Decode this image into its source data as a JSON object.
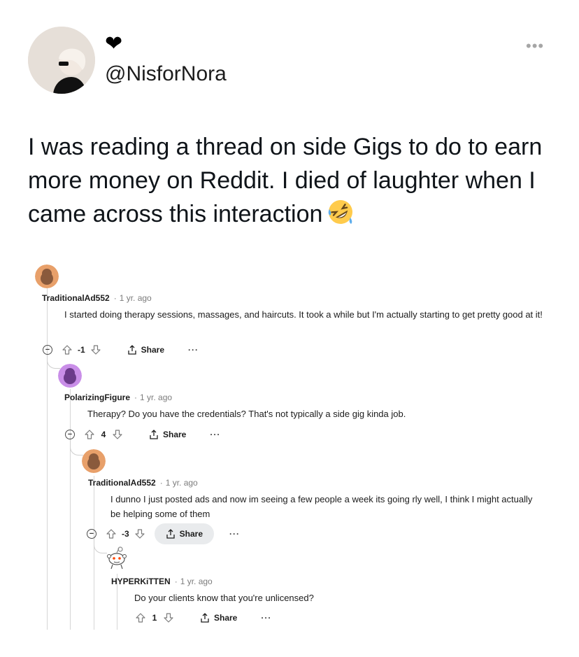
{
  "author": {
    "display_name_icon": "black-heart",
    "handle": "@NisforNora",
    "more_icon": "more-dots-icon"
  },
  "tweet": {
    "text": "I was reading a thread on side Gigs to do to earn more money on Reddit. I died of laughter when I came across this interaction",
    "emoji": "rolling-on-floor-laughing"
  },
  "colors": {
    "text": "#0f1419",
    "muted": "#7c7c7c",
    "avatar_orange": "#e8a06a",
    "avatar_purple": "#c98ee8",
    "share_pill": "#e9ebed"
  },
  "reddit": {
    "comments": [
      {
        "user": "TraditionalAd552",
        "dot": "·",
        "time": "1 yr. ago",
        "body": "I started doing therapy sessions, massages, and haircuts. It took a while but I'm actually starting to get pretty good at it!",
        "score": "-1",
        "share": "Share",
        "avatar": "orange-snoo"
      },
      {
        "user": "PolarizingFigure",
        "dot": "·",
        "time": "1 yr. ago",
        "body": "Therapy? Do you have the credentials? That's not typically a side gig kinda job.",
        "score": "4",
        "share": "Share",
        "avatar": "purple-snoo"
      },
      {
        "user": "TraditionalAd552",
        "dot": "·",
        "time": "1 yr. ago",
        "body": "I dunno I just posted ads and now im seeing a few people a week its going rly well, I think I might actually be helping some of them",
        "score": "-3",
        "share": "Share",
        "avatar": "orange-snoo"
      },
      {
        "user": "HYPERKiTTEN",
        "dot": "·",
        "time": "1 yr. ago",
        "body": "Do your clients know that you're unlicensed?",
        "score": "1",
        "share": "Share",
        "avatar": "default-snoo"
      }
    ]
  }
}
